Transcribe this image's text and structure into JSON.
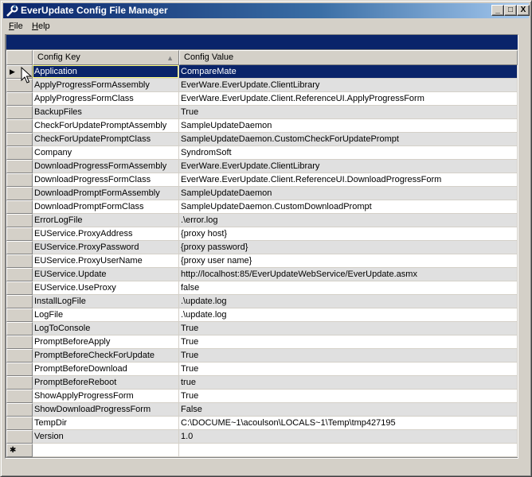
{
  "window": {
    "title": "EverUpdate Config File Manager",
    "controls": {
      "minimize": "_",
      "maximize": "□",
      "close": "X"
    }
  },
  "menu": {
    "items": [
      {
        "label": "File",
        "mnemonic": "F",
        "rest": "ile"
      },
      {
        "label": "Help",
        "mnemonic": "H",
        "rest": "elp"
      }
    ]
  },
  "grid": {
    "columns": [
      "Config Key",
      "Config Value"
    ],
    "sort_indicator": "▲",
    "current_row_glyph": "▶",
    "new_row_glyph": "✱",
    "selected_index": 0,
    "rows": [
      {
        "key": "Application",
        "value": "CompareMate"
      },
      {
        "key": "ApplyProgressFormAssembly",
        "value": "EverWare.EverUpdate.ClientLibrary"
      },
      {
        "key": "ApplyProgressFormClass",
        "value": "EverWare.EverUpdate.Client.ReferenceUI.ApplyProgressForm"
      },
      {
        "key": "BackupFiles",
        "value": "True"
      },
      {
        "key": "CheckForUpdatePromptAssembly",
        "value": "SampleUpdateDaemon"
      },
      {
        "key": "CheckForUpdatePromptClass",
        "value": "SampleUpdateDaemon.CustomCheckForUpdatePrompt"
      },
      {
        "key": "Company",
        "value": "SyndromSoft"
      },
      {
        "key": "DownloadProgressFormAssembly",
        "value": "EverWare.EverUpdate.ClientLibrary"
      },
      {
        "key": "DownloadProgressFormClass",
        "value": "EverWare.EverUpdate.Client.ReferenceUI.DownloadProgressForm"
      },
      {
        "key": "DownloadPromptFormAssembly",
        "value": "SampleUpdateDaemon"
      },
      {
        "key": "DownloadPromptFormClass",
        "value": "SampleUpdateDaemon.CustomDownloadPrompt"
      },
      {
        "key": "ErrorLogFile",
        "value": ".\\error.log"
      },
      {
        "key": "EUService.ProxyAddress",
        "value": "{proxy host}"
      },
      {
        "key": "EUService.ProxyPassword",
        "value": "{proxy password}"
      },
      {
        "key": "EUService.ProxyUserName",
        "value": "{proxy user name}"
      },
      {
        "key": "EUService.Update",
        "value": "http://localhost:85/EverUpdateWebService/EverUpdate.asmx"
      },
      {
        "key": "EUService.UseProxy",
        "value": "false"
      },
      {
        "key": "InstallLogFile",
        "value": ".\\update.log"
      },
      {
        "key": "LogFile",
        "value": ".\\update.log"
      },
      {
        "key": "LogToConsole",
        "value": "True"
      },
      {
        "key": "PromptBeforeApply",
        "value": "True"
      },
      {
        "key": "PromptBeforeCheckForUpdate",
        "value": "True"
      },
      {
        "key": "PromptBeforeDownload",
        "value": "True"
      },
      {
        "key": "PromptBeforeReboot",
        "value": "true"
      },
      {
        "key": "ShowApplyProgressForm",
        "value": "True"
      },
      {
        "key": "ShowDownloadProgressForm",
        "value": "False"
      },
      {
        "key": "TempDir",
        "value": "C:\\DOCUME~1\\acoulson\\LOCALS~1\\Temp\\tmp427195"
      },
      {
        "key": "Version",
        "value": "1.0"
      }
    ]
  },
  "colors": {
    "selection": "#0a246a",
    "alt_row": "#e0e0e0",
    "face": "#d4d0c8"
  }
}
